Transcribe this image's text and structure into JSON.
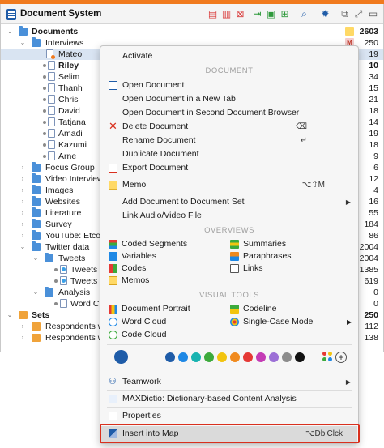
{
  "window": {
    "title": "Document System",
    "toolbar_icons": [
      "new-document-icon",
      "import-icon",
      "delete-icon",
      "export-icon",
      "add-folder-icon",
      "add-set-icon",
      "search-icon",
      "settings-icon",
      "undock-icon",
      "maximize-icon",
      "close-panel-icon"
    ]
  },
  "tree": [
    {
      "label": "Documents",
      "count": "2603",
      "bold": true
    },
    {
      "label": "Interviews",
      "count": "250"
    },
    {
      "label": "Mateo",
      "count": "19",
      "selected": true
    },
    {
      "label": "Riley",
      "count": "10",
      "bold": true
    },
    {
      "label": "Selim",
      "count": "34"
    },
    {
      "label": "Thanh",
      "count": "15"
    },
    {
      "label": "Chris",
      "count": "21"
    },
    {
      "label": "David",
      "count": "18"
    },
    {
      "label": "Tatjana",
      "count": "14"
    },
    {
      "label": "Amadi",
      "count": "19"
    },
    {
      "label": "Kazumi",
      "count": "18"
    },
    {
      "label": "Arne",
      "count": "9"
    },
    {
      "label": "Focus Group",
      "count": "6"
    },
    {
      "label": "Video Interview",
      "count": "12"
    },
    {
      "label": "Images",
      "count": "4"
    },
    {
      "label": "Websites",
      "count": "16"
    },
    {
      "label": "Literature",
      "count": "55"
    },
    {
      "label": "Survey",
      "count": "184"
    },
    {
      "label": "YouTube: Etcoff",
      "count": "86"
    },
    {
      "label": "Twitter data",
      "count": "2004"
    },
    {
      "label": "Tweets",
      "count": "2004"
    },
    {
      "label": "Tweets 1",
      "count": "1385"
    },
    {
      "label": "Tweets 10",
      "count": "619"
    },
    {
      "label": "Analysis",
      "count": "0"
    },
    {
      "label": "Word Clou",
      "count": "0"
    },
    {
      "label": "Sets",
      "count": "250",
      "bold": true
    },
    {
      "label": "Respondents wi",
      "count": "112"
    },
    {
      "label": "Respondents wi",
      "count": "138"
    }
  ],
  "menu": {
    "activate": "Activate",
    "section_document": "DOCUMENT",
    "open_document": "Open Document",
    "open_new_tab": "Open Document in a New Tab",
    "open_second_browser": "Open Document in Second Document Browser",
    "delete_document": "Delete Document",
    "delete_shortcut": "⌫",
    "rename_document": "Rename Document",
    "rename_shortcut": "↵",
    "duplicate_document": "Duplicate Document",
    "export_document": "Export Document",
    "memo": "Memo",
    "memo_shortcut": "⌥⇧M",
    "add_to_set": "Add Document to Document Set",
    "link_audio_video": "Link Audio/Video File",
    "section_overviews": "OVERVIEWS",
    "coded_segments": "Coded Segments",
    "summaries": "Summaries",
    "variables": "Variables",
    "paraphrases": "Paraphrases",
    "codes": "Codes",
    "links": "Links",
    "memos": "Memos",
    "section_visual_tools": "VISUAL TOOLS",
    "document_portrait": "Document Portrait",
    "codeline": "Codeline",
    "word_cloud": "Word Cloud",
    "single_case_model": "Single-Case Model",
    "code_cloud": "Code Cloud",
    "teamwork": "Teamwork",
    "maxdictio": "MAXDictio: Dictionary-based Content Analysis",
    "properties": "Properties",
    "insert_into_map": "Insert into Map",
    "insert_shortcut": "⌥DblClck"
  },
  "colors": {
    "accent_orange": "#f07a1e",
    "highlight_red": "#d9301e",
    "swatches": [
      "#1f5ca8",
      "#1f5ca8",
      "#1e88e5",
      "#18b3b0",
      "#3caa3c",
      "#f2c40f",
      "#f08a1e",
      "#e53935",
      "#c43bb5",
      "#9c6fd6",
      "#8c8c8c",
      "#111111"
    ]
  }
}
